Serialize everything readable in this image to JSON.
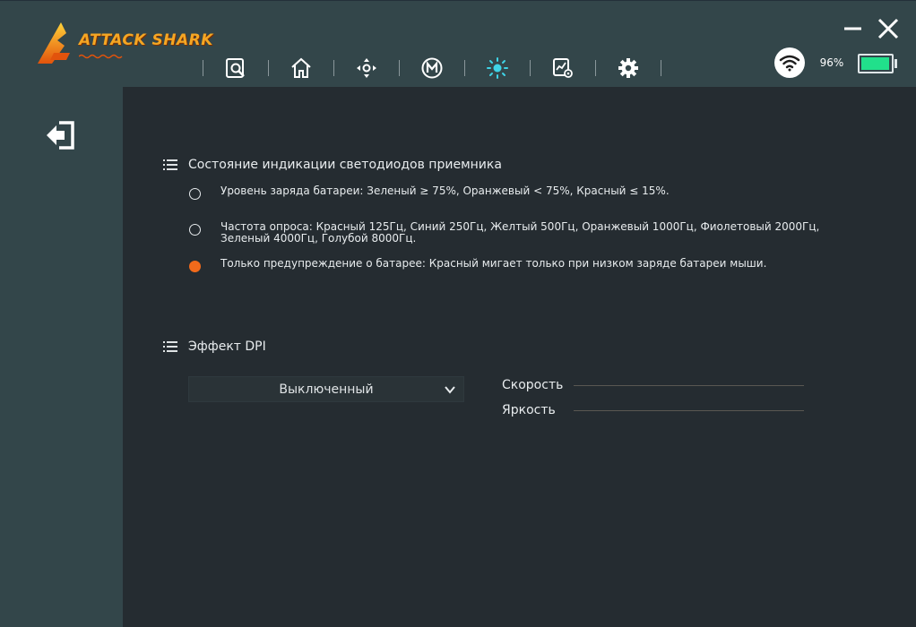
{
  "app": {
    "logo_text": "ATTACK SHARK"
  },
  "nav": [
    {
      "icon": "search-document-icon"
    },
    {
      "icon": "home-icon"
    },
    {
      "icon": "dpad-icon"
    },
    {
      "icon": "macro-m-icon"
    },
    {
      "icon": "light-icon",
      "active": true
    },
    {
      "icon": "performance-icon"
    },
    {
      "icon": "gear-icon"
    }
  ],
  "window": {
    "min_icon": "minimize-icon",
    "close_icon": "close-icon"
  },
  "status": {
    "battery_percent": "96%",
    "battery_level": 0.96,
    "connection_icon": "wifi-icon"
  },
  "colors": {
    "accent": "#f26a1b",
    "active_icon": "#3fd3e6",
    "battery": "#21e08b",
    "header_bg": "#33464a",
    "content_bg": "#252c31"
  },
  "led_section": {
    "title": "Состояние индикации светодиодов приемника",
    "options": [
      {
        "text": "Уровень заряда батареи: Зеленый ≥ 75%, Оранжевый < 75%, Красный ≤ 15%.",
        "selected": false
      },
      {
        "text": "Частота опроса: Красный 125Гц, Синий 250Гц, Желтый 500Гц, Оранжевый 1000Гц, Фиолетовый 2000Гц, Зеленый 4000Гц, Голубой 8000Гц.",
        "selected": false
      },
      {
        "text": "Только предупреждение о батарее: Красный мигает только при низком заряде батареи мыши.",
        "selected": true
      }
    ]
  },
  "dpi_section": {
    "title": "Эффект DPI",
    "dropdown_value": "Выключенный",
    "speed_label": "Скорость",
    "brightness_label": "Яркость"
  }
}
